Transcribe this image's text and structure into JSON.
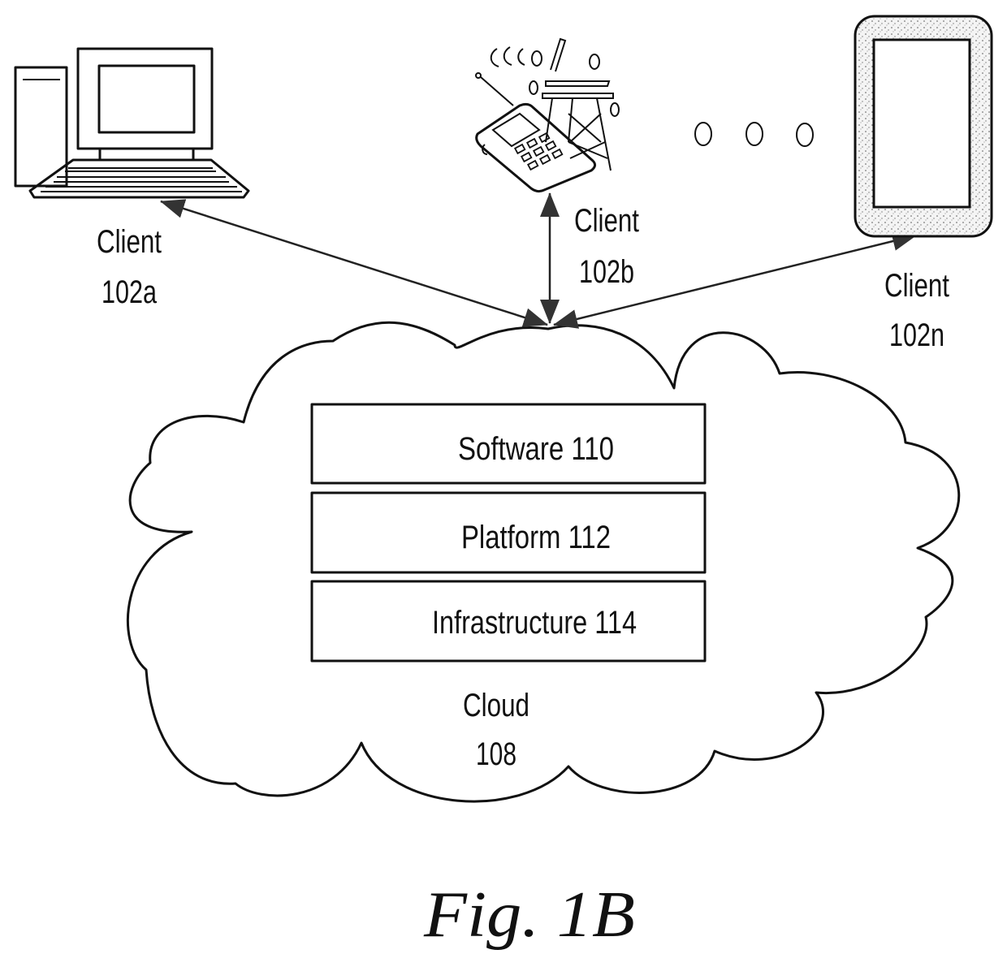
{
  "figure": {
    "caption": "Fig. 1B",
    "type": "cloud computing environment diagram"
  },
  "clients": [
    {
      "id": "102a",
      "label_line1": "Client",
      "label_line2": "102a",
      "device": "desktop-computer"
    },
    {
      "id": "102b",
      "label_line1": "Client",
      "label_line2": "102b",
      "device": "mobile-phone-with-cell-tower"
    },
    {
      "id": "102n",
      "label_line1": "Client",
      "label_line2": "102n",
      "device": "tablet"
    }
  ],
  "ellipsis": {
    "marks": [
      "o",
      "o",
      "o"
    ],
    "meaning": "additional clients"
  },
  "cloud": {
    "label_line1": "Cloud",
    "label_line2": "108",
    "layers": [
      {
        "name": "Software",
        "ref": "110",
        "text": "Software  110"
      },
      {
        "name": "Platform",
        "ref": "112",
        "text": "Platform  112"
      },
      {
        "name": "Infrastructure",
        "ref": "114",
        "text": "Infrastructure  114"
      }
    ]
  },
  "connections": [
    {
      "from": "102a",
      "to": "108",
      "bidirectional": true
    },
    {
      "from": "102b",
      "to": "108",
      "bidirectional": true
    },
    {
      "from": "102n",
      "to": "108",
      "bidirectional": true
    }
  ]
}
